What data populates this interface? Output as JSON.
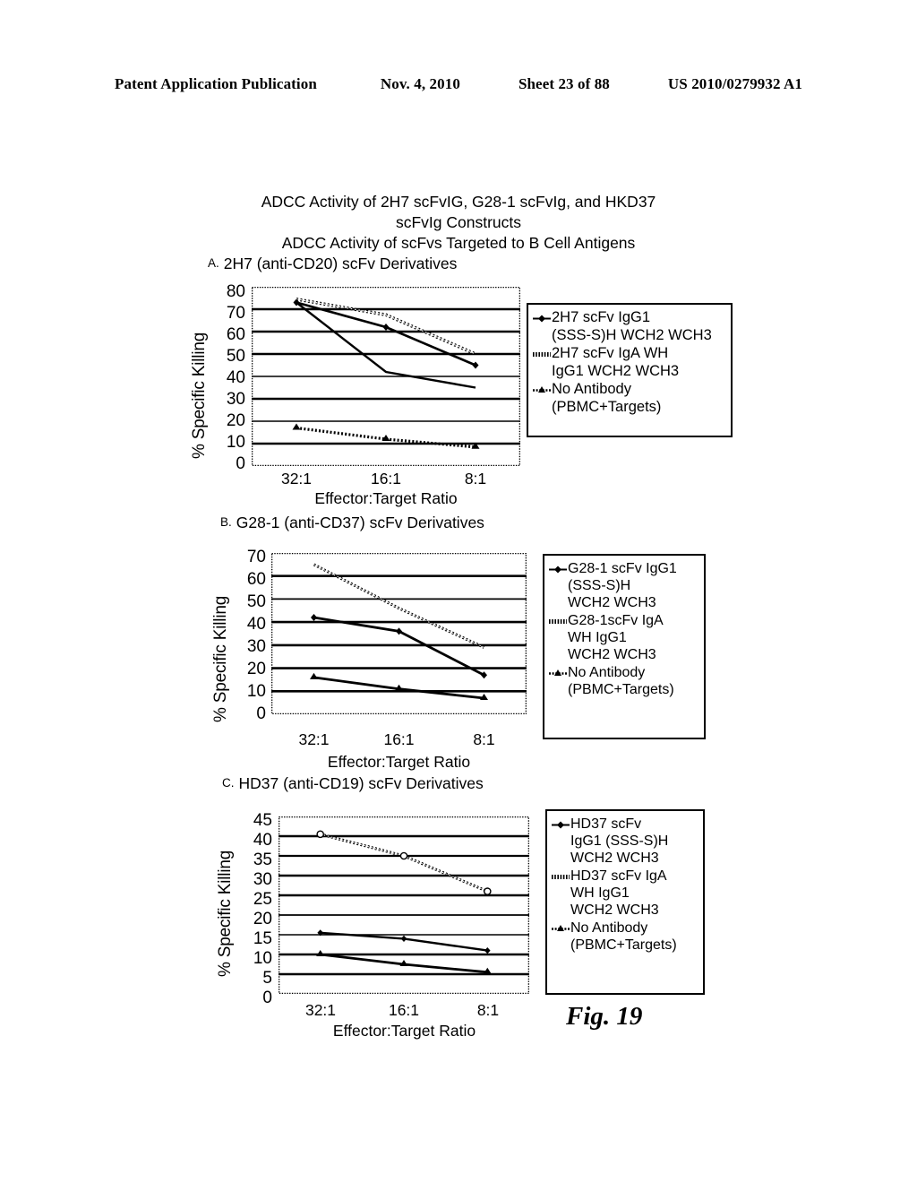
{
  "header": {
    "publication": "Patent Application Publication",
    "date": "Nov. 4, 2010",
    "sheet": "Sheet 23 of 88",
    "patent_number": "US 2010/0279932 A1"
  },
  "figure": {
    "title_line1": "ADCC Activity of 2H7 scFvIG, G28-1 scFvIg, and HKD37",
    "title_line2": "scFvIg Constructs",
    "title_line3": "ADCC Activity of scFvs Targeted to B Cell Antigens",
    "fig_number": "Fig. 19"
  },
  "panels": [
    {
      "letter": "A.",
      "caption": "2H7 (anti-CD20) scFv Derivatives",
      "legend": [
        {
          "marker": "diamond-line",
          "text": "2H7 scFv IgG1\n(SSS-S)H WCH2 WCH3"
        },
        {
          "marker": "hatched-line",
          "text": "2H7 scFv IgA WH\nIgG1 WCH2 WCH3"
        },
        {
          "marker": "triangle-line",
          "text": "No Antibody\n(PBMC+Targets)"
        }
      ]
    },
    {
      "letter": "B.",
      "caption": "G28-1 (anti-CD37) scFv Derivatives",
      "legend": [
        {
          "marker": "diamond-line",
          "text": "G28-1 scFv IgG1\n(SSS-S)H\nWCH2 WCH3"
        },
        {
          "marker": "hatched-line",
          "text": "G28-1scFv IgA\nWH IgG1\nWCH2 WCH3"
        },
        {
          "marker": "triangle-line",
          "text": "No Antibody\n(PBMC+Targets)"
        }
      ]
    },
    {
      "letter": "C.",
      "caption": "HD37 (anti-CD19) scFv Derivatives",
      "legend": [
        {
          "marker": "diamond-line",
          "text": "HD37 scFv\nIgG1 (SSS-S)H\nWCH2 WCH3"
        },
        {
          "marker": "hatched-line",
          "text": "HD37 scFv IgA\nWH IgG1\nWCH2 WCH3"
        },
        {
          "marker": "triangle-line",
          "text": "No Antibody\n(PBMC+Targets)"
        }
      ]
    }
  ],
  "chart_data": [
    {
      "type": "line",
      "panel": "A",
      "title": "2H7 (anti-CD20) scFv Derivatives",
      "xlabel": "Effector:Target Ratio",
      "ylabel": "% Specific Killing",
      "categories": [
        "32:1",
        "16:1",
        "8:1"
      ],
      "yticks": [
        0,
        10,
        20,
        30,
        40,
        50,
        60,
        70,
        80
      ],
      "ylim": [
        0,
        80
      ],
      "grid": true,
      "legend_position": "right",
      "series": [
        {
          "name": "2H7 scFv IgG1 (SSS-S)H WCH2 WCH3",
          "marker": "diamond-line",
          "values": [
            73,
            62,
            45
          ]
        },
        {
          "name": "2H7 scFv IgA WH IgG1 WCH2 WCH3",
          "marker": "hatched-line",
          "values": [
            74.5,
            67.5,
            50
          ]
        },
        {
          "name": "No Antibody (PBMC+Targets)",
          "marker": "triangle-line",
          "values": [
            17,
            12,
            8.5
          ]
        }
      ]
    },
    {
      "type": "line",
      "panel": "B",
      "title": "G28-1 (anti-CD37) scFv Derivatives",
      "xlabel": "Effector:Target Ratio",
      "ylabel": "% Specific Killing",
      "categories": [
        "32:1",
        "16:1",
        "8:1"
      ],
      "yticks": [
        0,
        10,
        20,
        30,
        40,
        50,
        60,
        70
      ],
      "ylim": [
        0,
        70
      ],
      "grid": true,
      "legend_position": "right",
      "series": [
        {
          "name": "G28-1 scFv IgG1 (SSS-S)H WCH2 WCH3",
          "marker": "diamond-line",
          "values": [
            42,
            36,
            17
          ]
        },
        {
          "name": "G28-1scFv IgA WH IgG1 WCH2 WCH3",
          "marker": "hatched-line",
          "values": [
            65,
            46,
            29
          ]
        },
        {
          "name": "No Antibody (PBMC+Targets)",
          "marker": "triangle-line",
          "values": [
            16,
            11,
            7
          ]
        }
      ]
    },
    {
      "type": "line",
      "panel": "C",
      "title": "HD37 (anti-CD19) scFv Derivatives",
      "xlabel": "Effector:Target Ratio",
      "ylabel": "% Specific Killing",
      "categories": [
        "32:1",
        "16:1",
        "8:1"
      ],
      "yticks": [
        0,
        5,
        10,
        15,
        20,
        25,
        30,
        35,
        40,
        45
      ],
      "ylim": [
        0,
        45
      ],
      "grid": true,
      "legend_position": "right",
      "series": [
        {
          "name": "HD37 scFv IgG1 (SSS-S)H WCH2 WCH3",
          "marker": "diamond-line",
          "values": [
            15.5,
            14,
            11
          ]
        },
        {
          "name": "HD37 scFv IgA WH IgG1 WCH2 WCH3",
          "marker": "hatched-line",
          "values": [
            40.5,
            35,
            26
          ]
        },
        {
          "name": "No Antibody (PBMC+Targets)",
          "marker": "triangle-line",
          "values": [
            10,
            7.5,
            5.5
          ]
        }
      ]
    }
  ]
}
